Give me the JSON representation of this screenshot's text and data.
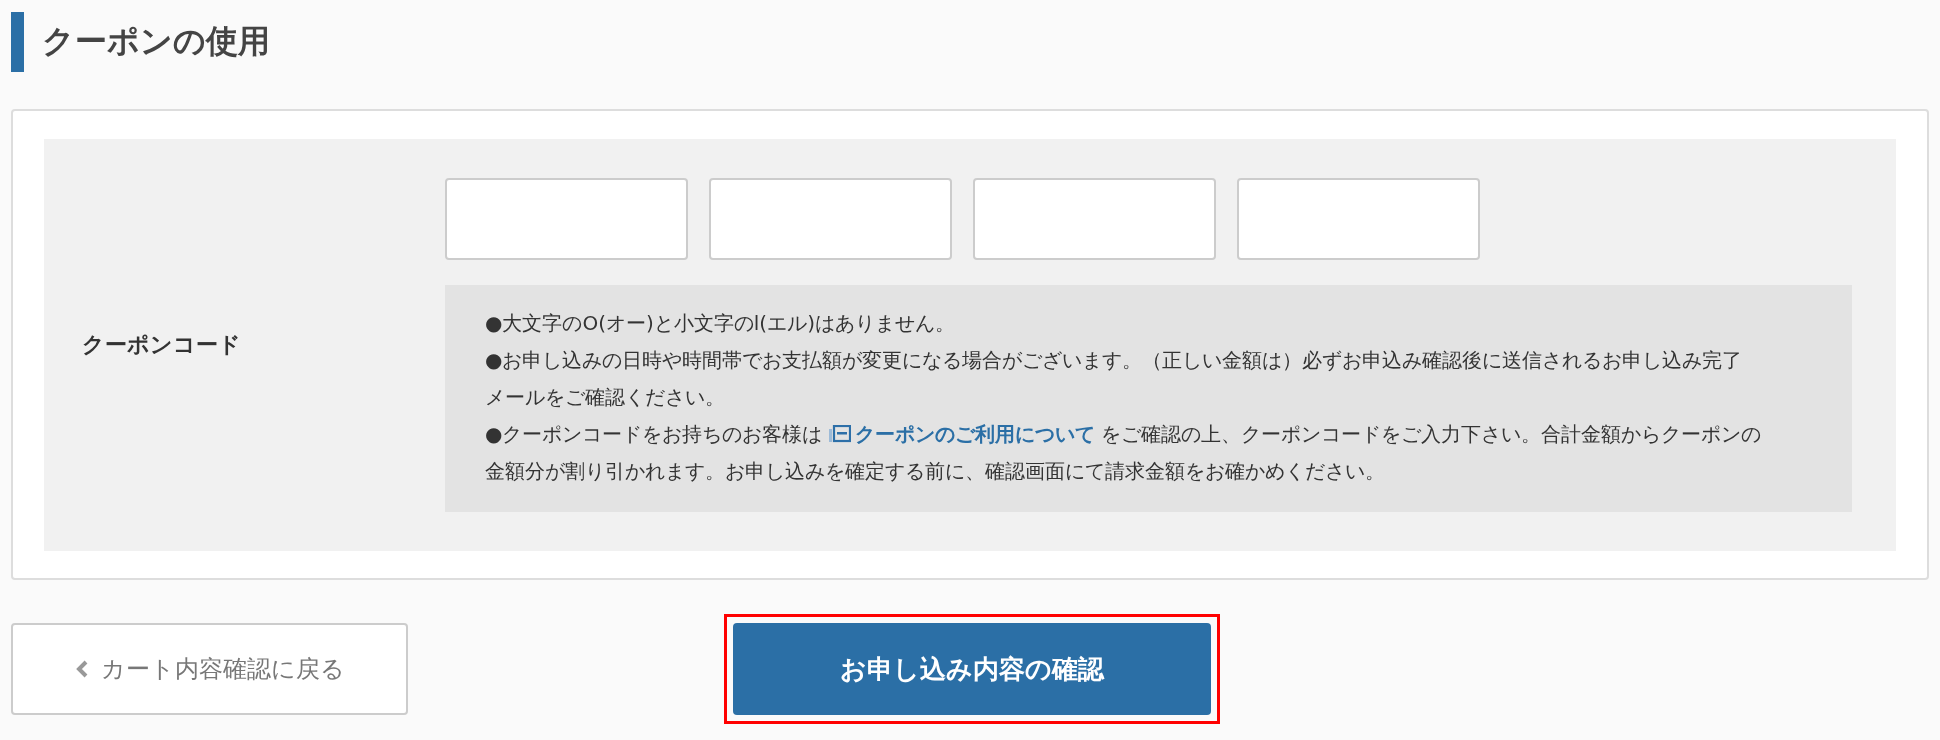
{
  "section": {
    "title": "クーポンの使用"
  },
  "coupon": {
    "label": "クーポンコード",
    "code_fields": [
      {
        "kind": "text"
      },
      {
        "kind": "text"
      },
      {
        "kind": "text"
      },
      {
        "kind": "text"
      }
    ],
    "notes": [
      {
        "kind": "plain",
        "text": "●大文字のO(オー)と小文字のl(エル)はありません。"
      },
      {
        "kind": "plain",
        "text": "●お申し込みの日時や時間帯でお支払額が変更になる場合がございます。（正しい金額は）必ずお申込み確認後に送信されるお申し込み完了メールをご確認ください。"
      },
      {
        "kind": "link",
        "before": "●クーポンコードをお持ちのお客様は ",
        "link": "クーポンのご利用について",
        "after": " をご確認の上、クーポンコードをご入力下さい。合計金額からクーポンの金額分が割り引かれます。お申し込みを確定する前に、確認画面にて請求金額をお確かめください。"
      }
    ]
  },
  "buttons": {
    "back": {
      "label": "カート内容確認に戻る"
    },
    "confirm": {
      "label": "お申し込み内容の確認",
      "highlighted": true
    }
  }
}
